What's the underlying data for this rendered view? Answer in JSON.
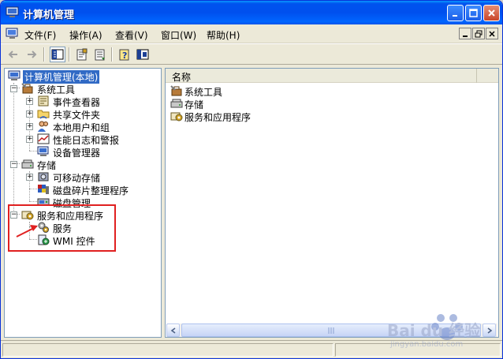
{
  "window": {
    "title": "计算机管理",
    "title_icon": "computer-management-icon",
    "controls": [
      "minimize-icon",
      "maximize-icon",
      "close-icon"
    ]
  },
  "menubar": {
    "items": [
      {
        "label": "文件(F)"
      },
      {
        "label": "操作(A)"
      },
      {
        "label": "查看(V)"
      },
      {
        "label": "窗口(W)"
      },
      {
        "label": "帮助(H)"
      }
    ]
  },
  "toolbar": {
    "buttons": [
      "back-arrow-icon",
      "forward-arrow-icon",
      "show-hide-tree-icon",
      "properties-icon",
      "export-list-icon",
      "help-icon",
      "console-view-icon"
    ]
  },
  "tree": {
    "root": "计算机管理(本地)",
    "system_tools": "系统工具",
    "event_viewer": "事件查看器",
    "shared_folders": "共享文件夹",
    "local_users": "本地用户和组",
    "perf_logs": "性能日志和警报",
    "device_manager": "设备管理器",
    "storage": "存储",
    "removable_storage": "可移动存储",
    "defrag": "磁盘碎片整理程序",
    "disk_mgmt": "磁盘管理",
    "services_apps": "服务和应用程序",
    "services": "服务",
    "wmi": "WMI 控件"
  },
  "list": {
    "column_name": "名称",
    "items": [
      "系统工具",
      "存储",
      "服务和应用程序"
    ]
  },
  "watermark": {
    "brand": "Bai du 经验",
    "url": "jingyan.baidu.com"
  },
  "colors": {
    "title_blue": "#0053ee",
    "selection": "#316ac5",
    "annotation_red": "#e02020"
  }
}
